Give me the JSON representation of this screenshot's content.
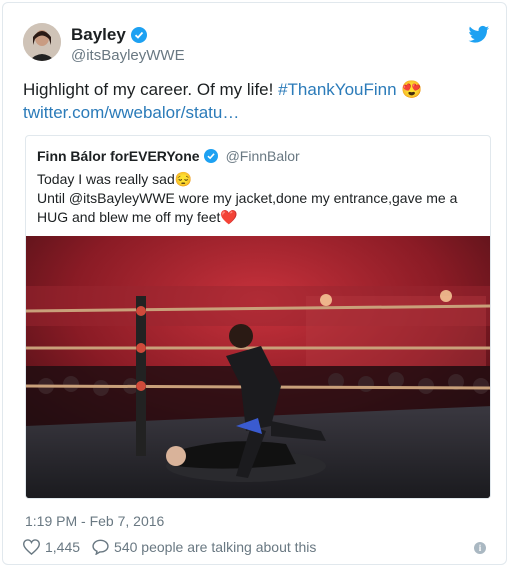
{
  "tweet": {
    "author_name": "Bayley",
    "author_handle": "@itsBayleyWWE",
    "text_main": "Highlight of my career. Of my life! ",
    "hashtag": "#ThankYouFinn",
    "emoji": "😍",
    "link": "twitter.com/wwebalor/statu…",
    "timestamp": "1:19 PM - Feb 7, 2016",
    "like_count": "1,445",
    "talking": "540 people are talking about this"
  },
  "quoted": {
    "author_name": "Finn Bálor forEVERYone",
    "author_handle": "@FinnBalor",
    "line1": "Today I was really sad",
    "line1_emoji": "😔",
    "line2": "Until @itsBayleyWWE wore my jacket,done my entrance,gave me a HUG and blew me off my feet",
    "line2_emoji": "❤️"
  },
  "colors": {
    "link_blue": "#2b7bb9",
    "verified_blue": "#1da1f2",
    "muted": "#697882"
  },
  "icons": [
    "twitter-bird-icon",
    "verified-icon",
    "heart-icon",
    "comment-icon",
    "info-icon"
  ]
}
